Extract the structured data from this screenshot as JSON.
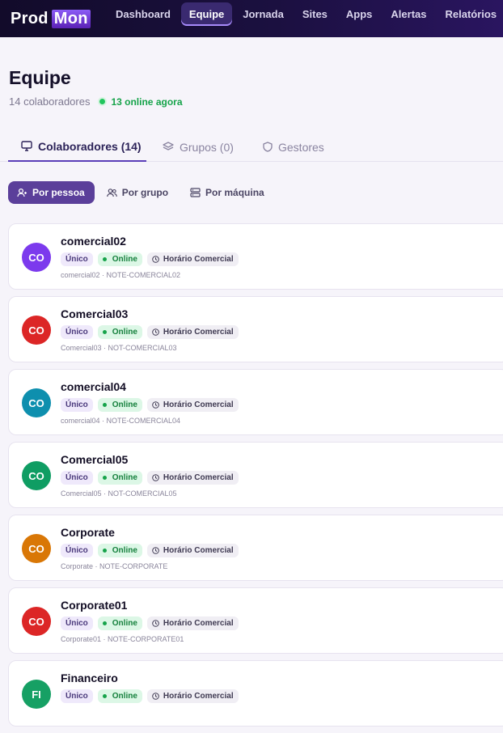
{
  "brand": {
    "part1": "Prod",
    "part2": "Mon"
  },
  "nav": [
    {
      "label": "Dashboard",
      "active": false
    },
    {
      "label": "Equipe",
      "active": true
    },
    {
      "label": "Jornada",
      "active": false
    },
    {
      "label": "Sites",
      "active": false
    },
    {
      "label": "Apps",
      "active": false
    },
    {
      "label": "Alertas",
      "active": false
    },
    {
      "label": "Relatórios",
      "active": false
    }
  ],
  "page": {
    "title": "Equipe",
    "count": "14 colaboradores",
    "online": "13 online agora"
  },
  "tabs": [
    {
      "label": "Colaboradores (14)",
      "active": true
    },
    {
      "label": "Grupos (0)",
      "active": false
    },
    {
      "label": "Gestores",
      "active": false
    }
  ],
  "view_filters": [
    {
      "label": "Por pessoa",
      "active": true
    },
    {
      "label": "Por grupo",
      "active": false
    },
    {
      "label": "Por máquina",
      "active": false
    }
  ],
  "colors": {
    "accent": "#5b3f9a",
    "online": "#22c55e"
  },
  "collaborators": [
    {
      "initials": "CO",
      "name": "comercial02",
      "type": "Único",
      "status": "Online",
      "schedule": "Horário Comercial",
      "meta": "comercial02 · NOTE-COMERCIAL02",
      "color": "#7c3aed"
    },
    {
      "initials": "CO",
      "name": "Comercial03",
      "type": "Único",
      "status": "Online",
      "schedule": "Horário Comercial",
      "meta": "Comercial03 · NOT-COMERCIAL03",
      "color": "#dc2626"
    },
    {
      "initials": "CO",
      "name": "comercial04",
      "type": "Único",
      "status": "Online",
      "schedule": "Horário Comercial",
      "meta": "comercial04 · NOTE-COMERCIAL04",
      "color": "#0e8fae"
    },
    {
      "initials": "CO",
      "name": "Comercial05",
      "type": "Único",
      "status": "Online",
      "schedule": "Horário Comercial",
      "meta": "Comercial05 · NOT-COMERCIAL05",
      "color": "#0f9d63"
    },
    {
      "initials": "CO",
      "name": "Corporate",
      "type": "Único",
      "status": "Online",
      "schedule": "Horário Comercial",
      "meta": "Corporate · NOTE-CORPORATE",
      "color": "#d97706"
    },
    {
      "initials": "CO",
      "name": "Corporate01",
      "type": "Único",
      "status": "Online",
      "schedule": "Horário Comercial",
      "meta": "Corporate01 · NOTE-CORPORATE01",
      "color": "#dc2626"
    },
    {
      "initials": "FI",
      "name": "Financeiro",
      "type": "Único",
      "status": "Online",
      "schedule": "Horário Comercial",
      "meta": "",
      "color": "#16a064"
    }
  ]
}
